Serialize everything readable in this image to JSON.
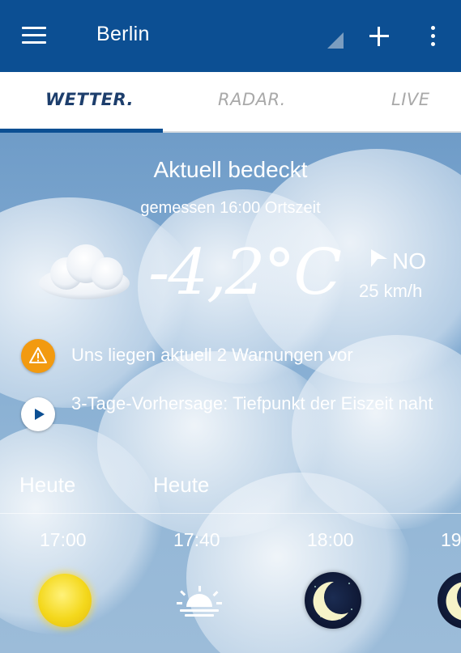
{
  "appbar": {
    "title": "Berlin",
    "bg_color": "#0c4f93",
    "menu_icon": "hamburger-menu",
    "add_icon": "plus",
    "more_icon": "vertical-dots"
  },
  "tabs": [
    {
      "label": "WETTER.",
      "active": true
    },
    {
      "label": "RADAR.",
      "active": false
    },
    {
      "label": "LIVE",
      "active": false
    }
  ],
  "current": {
    "condition": "Aktuell bedeckt",
    "measured": "gemessen 16:00 Ortszeit",
    "weather_icon": "cloud",
    "temperature": "-4,2°C",
    "wind_direction": "NO",
    "wind_speed": "25 km/h"
  },
  "notices": [
    {
      "icon": "warning",
      "text": "Uns liegen aktuell 2 Warnungen vor"
    },
    {
      "icon": "play",
      "text": "3-Tage-Vorhersage: Tiefpunkt der Eiszeit naht"
    }
  ],
  "days": [
    "Heute",
    "Heute"
  ],
  "hourly": [
    {
      "time": "17:00",
      "icon": "sun"
    },
    {
      "time": "17:40",
      "icon": "sunset"
    },
    {
      "time": "18:00",
      "icon": "moon"
    },
    {
      "time": "19",
      "icon": "moon"
    }
  ],
  "colors": {
    "accent": "#0c4f93",
    "warning": "#f29a10",
    "tab_inactive": "#a9a9a9"
  }
}
